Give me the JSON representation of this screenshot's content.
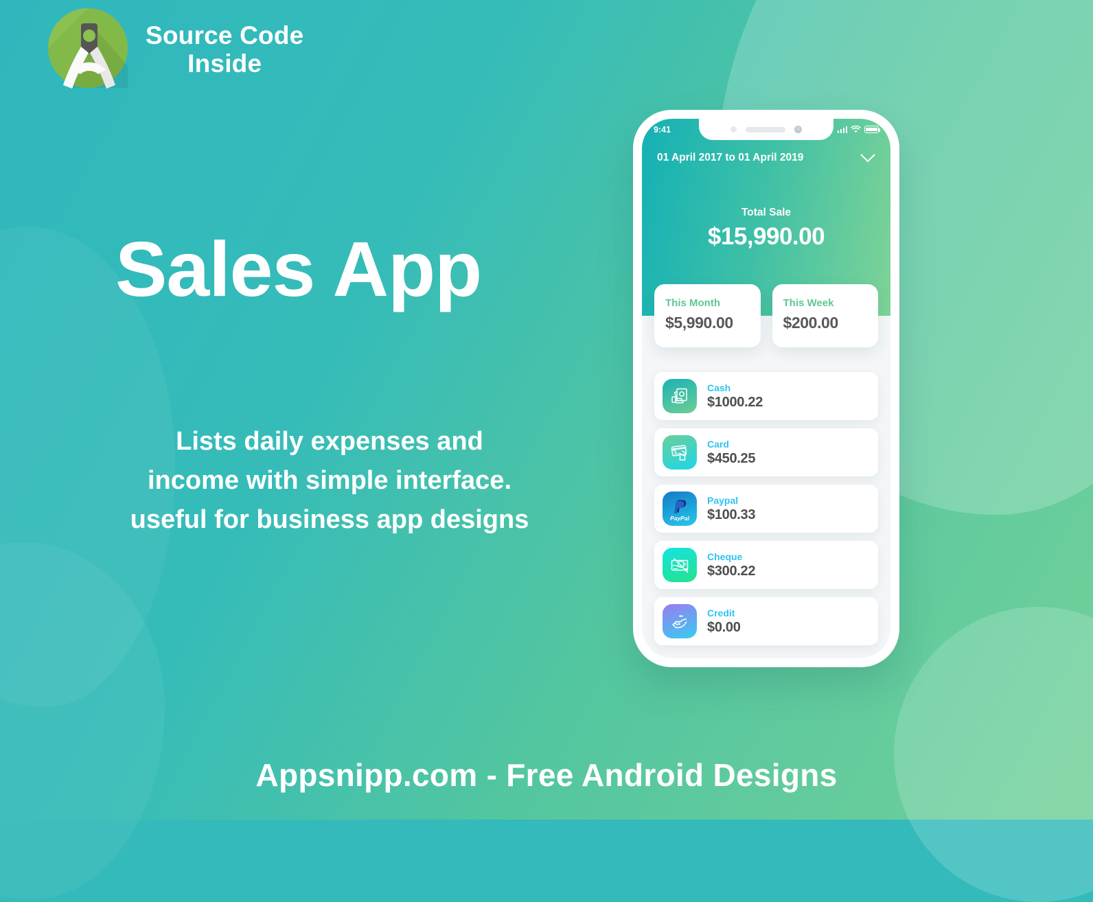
{
  "brand": {
    "line1": "Source Code",
    "line2": "Inside",
    "logo_icon": "android-studio-compass-icon"
  },
  "hero": {
    "headline": "Sales App",
    "description_lines": [
      "Lists daily expenses and",
      "income with simple interface.",
      "useful for business app designs"
    ]
  },
  "footer": {
    "text": "Appsnipp.com - Free Android Designs"
  },
  "phone": {
    "status_bar": {
      "time": "9:41",
      "signal_icon": "signal-bars-icon",
      "wifi_icon": "wifi-icon",
      "battery_icon": "battery-full-icon"
    },
    "header": {
      "date_range": "01 April 2017 to 01 April 2019",
      "dropdown_icon": "chevron-down-icon",
      "total_label": "Total Sale",
      "total_value": "$15,990.00"
    },
    "stats": [
      {
        "label": "This Month",
        "value": "$5,990.00"
      },
      {
        "label": "This Week",
        "value": "$200.00"
      }
    ],
    "payments": [
      {
        "name": "Cash",
        "amount": "$1000.22",
        "icon": "banknotes-icon",
        "grad_from": "#1cb2b8",
        "grad_to": "#6cce93",
        "name_color": "#2ec4ef"
      },
      {
        "name": "Card",
        "amount": "$450.25",
        "icon": "credit-card-hand-icon",
        "grad_from": "#6ace9a",
        "grad_to": "#1fd6e8",
        "name_color": "#2ec4ef"
      },
      {
        "name": "Paypal",
        "amount": "$100.33",
        "icon": "paypal-icon",
        "grad_from": "#1479c9",
        "grad_to": "#27c8e8",
        "name_color": "#2ec4ef"
      },
      {
        "name": "Cheque",
        "amount": "$300.22",
        "icon": "cheque-pen-icon",
        "grad_from": "#16e3e3",
        "grad_to": "#22e38c",
        "name_color": "#2ec4ef"
      },
      {
        "name": "Credit",
        "amount": "$0.00",
        "icon": "hand-coin-icon",
        "grad_from": "#9a7cf0",
        "grad_to": "#36cdf0",
        "name_color": "#2ec4ef"
      }
    ]
  },
  "colors": {
    "background_teal": "#34baba",
    "background_green": "#72d09a",
    "header_gradient_from": "#14b1b6",
    "header_gradient_to": "#7ed396",
    "stat_label_green": "#5ec792",
    "amount_gray": "#4e4e4e",
    "payment_label_blue": "#2ec4ef"
  }
}
